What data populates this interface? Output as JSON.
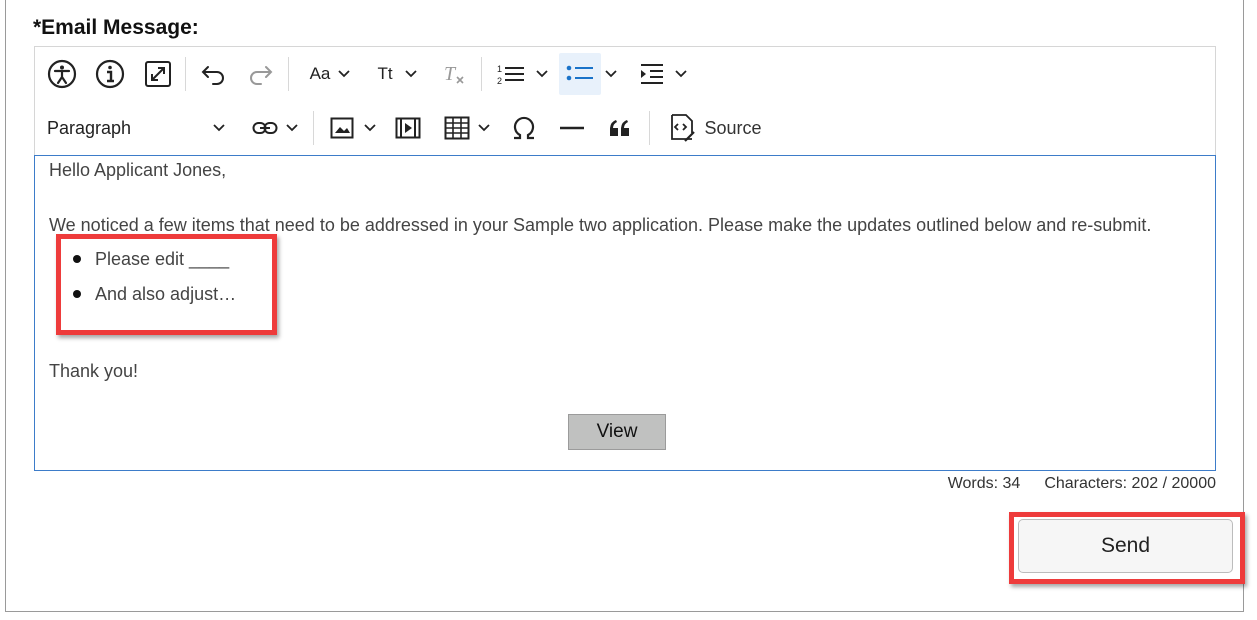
{
  "form": {
    "label": "*Email Message:"
  },
  "toolbar": {
    "row1": [
      {
        "name": "accessibility-button",
        "icon": "accessibility-icon"
      },
      {
        "name": "info-button",
        "icon": "info-icon"
      },
      {
        "name": "fullscreen-button",
        "icon": "expand-icon"
      },
      {
        "name": "undo-button",
        "icon": "undo-icon"
      },
      {
        "name": "redo-button",
        "icon": "redo-icon"
      },
      {
        "name": "font-family-button",
        "text": "Aa"
      },
      {
        "name": "font-size-button",
        "text": "Tt"
      },
      {
        "name": "remove-format-button",
        "icon": "remove-format-icon"
      },
      {
        "name": "numbered-list-button",
        "icon": "numbered-list-icon"
      },
      {
        "name": "bulleted-list-button",
        "icon": "bulleted-list-icon",
        "active": true
      },
      {
        "name": "indent-button",
        "icon": "indent-icon"
      }
    ],
    "font_family_label": "Aa",
    "font_size_label": "Tt",
    "paragraph_label": "Paragraph",
    "source_label": "Source",
    "row2_icons": [
      "link-icon",
      "image-icon",
      "media-icon",
      "table-icon",
      "omega-icon",
      "horizontal-line-icon",
      "blockquote-icon",
      "source-icon"
    ]
  },
  "editor": {
    "greeting": "Hello Applicant Jones,",
    "body": "We noticed a few items that need to be addressed in your Sample two application. Please make the updates outlined below and re-submit.",
    "bullets": [
      "Please edit ____",
      "And also adjust…"
    ],
    "closing": "Thank you!",
    "view_button": "View"
  },
  "counter": {
    "words": "Words: 34",
    "characters": "Characters: 202 / 20000"
  },
  "actions": {
    "send_label": "Send"
  },
  "colors": {
    "highlight": "#ee3b3b",
    "editor_border": "#3d7cc9",
    "active_button_bg": "#e8f1fb",
    "bullet_icon_blue": "#1a73c9"
  }
}
